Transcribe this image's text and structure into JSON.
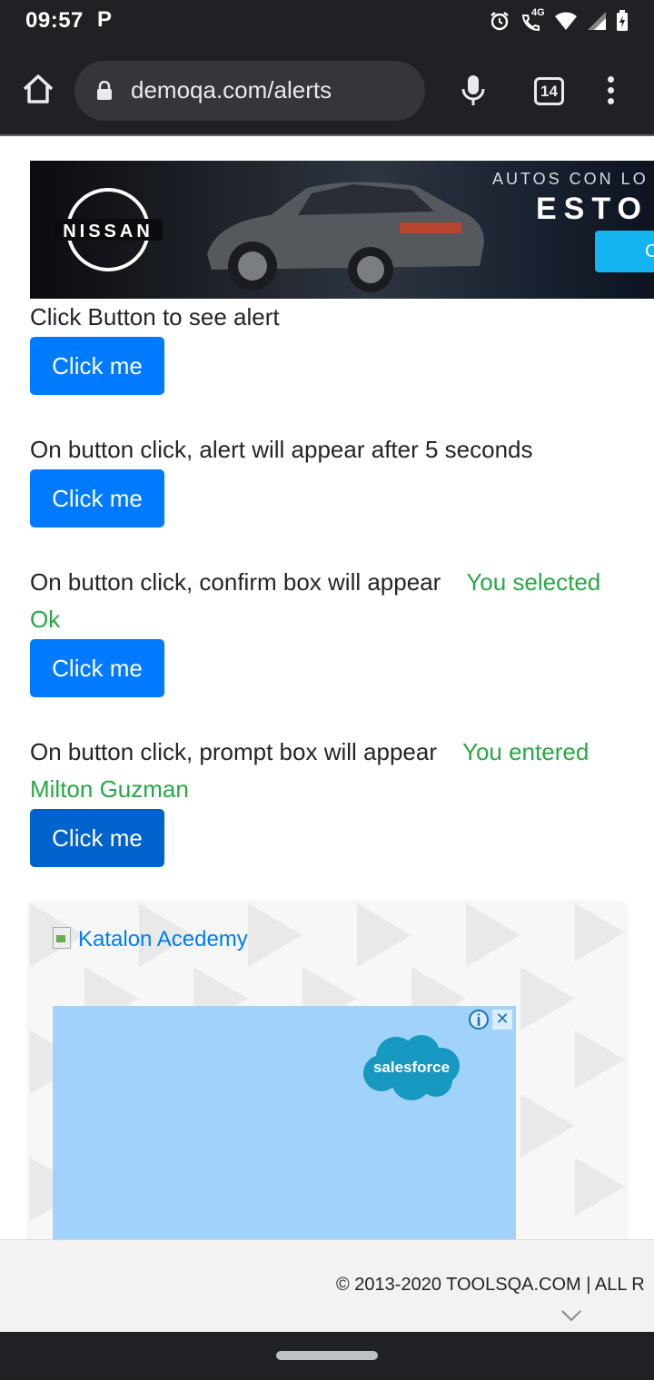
{
  "status_bar": {
    "time": "09:57",
    "notification": "P",
    "network": "4G"
  },
  "browser": {
    "url": "demoqa.com/alerts",
    "tab_count": "14"
  },
  "ad_banner": {
    "brand": "NISSAN",
    "tagline_top": "AUTOS CON LO",
    "tagline_bottom": "ESTO",
    "cta": "C"
  },
  "alerts": [
    {
      "label": "Click Button to see alert",
      "result": "",
      "button": "Click me"
    },
    {
      "label": "On button click, alert will appear after 5 seconds",
      "result": "",
      "button": "Click me"
    },
    {
      "label": "On button click, confirm box will appear",
      "result": "You selected Ok",
      "button": "Click me"
    },
    {
      "label": "On button click, prompt box will appear",
      "result": "You entered Milton Guzman",
      "button": "Click me"
    }
  ],
  "promo": {
    "image_alt": "Katalon Acedemy",
    "ad_brand": "salesforce",
    "ad_info": "i",
    "ad_close": "✕"
  },
  "footer": {
    "copyright": "© 2013-2020 TOOLSQA.COM | ALL R"
  },
  "colors": {
    "primary_button": "#007bff",
    "result_text": "#28a745",
    "chrome_dark": "#202124"
  }
}
